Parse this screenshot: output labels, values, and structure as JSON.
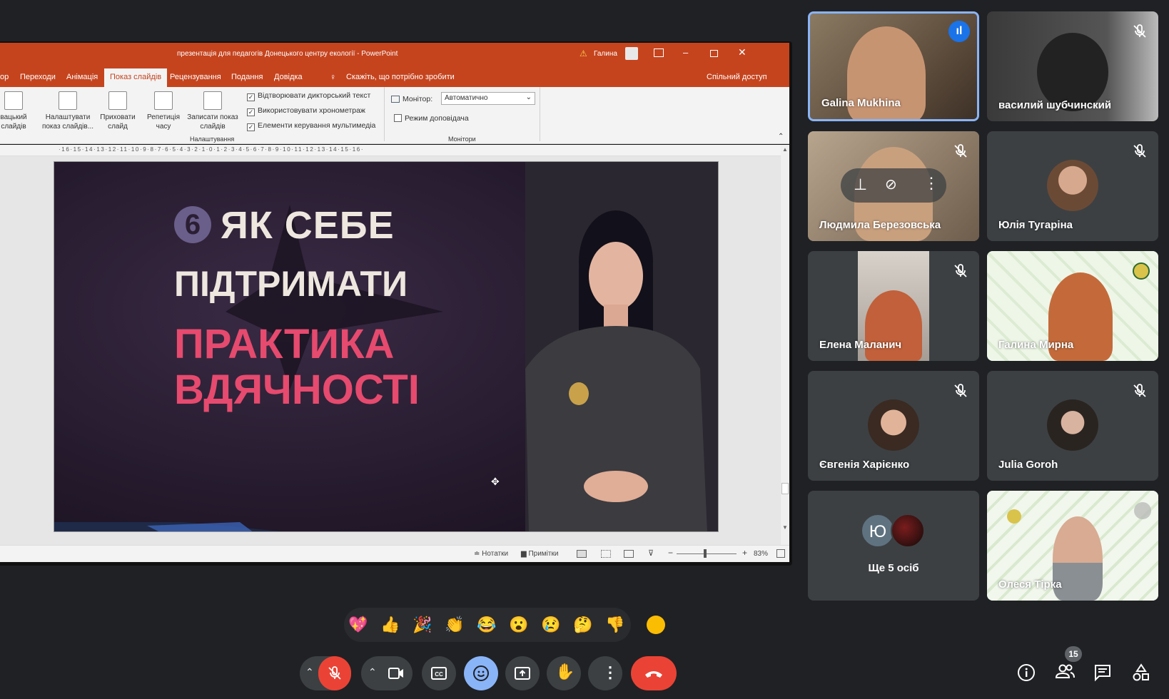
{
  "powerpoint": {
    "title": "презентація для педагогів Донецького центру екології  -  PowerPoint",
    "user": "Галина",
    "tabs": [
      "ор",
      "Переходи",
      "Анімація",
      "Показ слайдів",
      "Рецензування",
      "Подання",
      "Довідка"
    ],
    "active_tab": "Показ слайдів",
    "tell_me": "Скажіть, що потрібно зробити",
    "share": "Спільний доступ",
    "ribbon": {
      "custom_show": "вацький\nслайдів",
      "setup": "Налаштувати\nпоказ слайдів...",
      "hide": "Приховати\nслайд",
      "rehearse": "Репетиція\nчасу",
      "record": "Записати показ\nслайдів",
      "check1": "Відтворювати дикторський текст",
      "check2": "Використовувати хронометраж",
      "check3": "Елементи керування мультимедіа",
      "group1": "Налаштування",
      "monitor_label": "Монітор:",
      "monitor_value": "Автоматично",
      "presenter": "Режим доповідача",
      "group2": "Монітори"
    },
    "ruler": "·16·15·14·13·12·11·10·9·8·7·6·5·4·3·2·1·0·1·2·3·4·5·6·7·8·9·10·11·12·13·14·15·16·",
    "slide": {
      "number": "6",
      "line1": "ЯК СЕБЕ",
      "line2": "ПІДТРИМАТИ",
      "line3": "ПРАКТИКА",
      "line4": "ВДЯЧНОСТІ"
    },
    "status": {
      "notes": "Нотатки",
      "comments": "Примітки",
      "zoom": "83%"
    }
  },
  "participants": [
    {
      "name": "Galina Mukhina",
      "speaking": true
    },
    {
      "name": "василий шубчинский",
      "muted": true
    },
    {
      "name": "Людмила Березовська",
      "muted": true
    },
    {
      "name": "Юлія Тугаріна",
      "muted": true
    },
    {
      "name": "Елена Маланич",
      "muted": true
    },
    {
      "name": "Галина Мирна",
      "muted": false
    },
    {
      "name": "Євгенія Харієнко",
      "muted": true
    },
    {
      "name": "Julia Goroh",
      "muted": true
    },
    {
      "name": "Ще 5 осіб",
      "initial": "Ю"
    },
    {
      "name": "Олеся Тірка",
      "muted": false
    }
  ],
  "emojis": [
    "💖",
    "👍",
    "🎉",
    "👏",
    "😂",
    "😮",
    "😢",
    "🤔",
    "👎"
  ],
  "people_count": "15",
  "colors": {
    "bg": "#202124",
    "tile": "#3c4043",
    "accent": "#8ab4f8",
    "ppt": "#c5441e",
    "hangup": "#ea4335"
  }
}
